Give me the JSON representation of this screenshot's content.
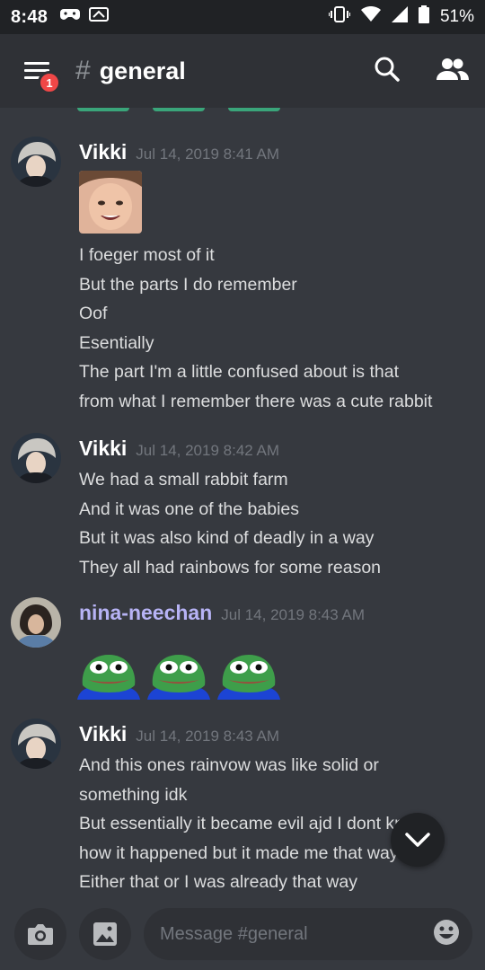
{
  "status_bar": {
    "time": "8:48",
    "battery": "51%"
  },
  "header": {
    "notification_count": "1",
    "channel_hash": "#",
    "channel_name": "general"
  },
  "messages": [
    {
      "author": "Vikki",
      "timestamp": "Jul 14, 2019 8:41 AM",
      "has_photo": true,
      "lines": [
        "I foeger most of it",
        "But the parts I do remember",
        "Oof",
        "Esentially",
        "The part I'm a little confused about is that",
        "from what I remember there was a cute rabbit"
      ]
    },
    {
      "author": "Vikki",
      "timestamp": "Jul 14, 2019 8:42 AM",
      "lines": [
        "We had a small rabbit farm",
        "And it was one of the babies",
        "But it was also kind of deadly in a way",
        "They all had rainbows for some reason"
      ]
    },
    {
      "author": "nina-neechan",
      "timestamp": "Jul 14, 2019 8:43 AM",
      "emoji_count": 3
    },
    {
      "author": "Vikki",
      "timestamp": "Jul 14, 2019 8:43 AM",
      "lines": [
        "And this ones rainvow was like solid or",
        "something idk",
        "But essentially it became evil ajd I dont know",
        "how it happened but it made me that way too",
        "Either that or I was already that way"
      ]
    }
  ],
  "composer": {
    "placeholder": "Message #general"
  },
  "colors": {
    "background": "#36393f",
    "header": "#2f3136",
    "badge": "#f04747",
    "nina_name": "#b7b3f5"
  }
}
